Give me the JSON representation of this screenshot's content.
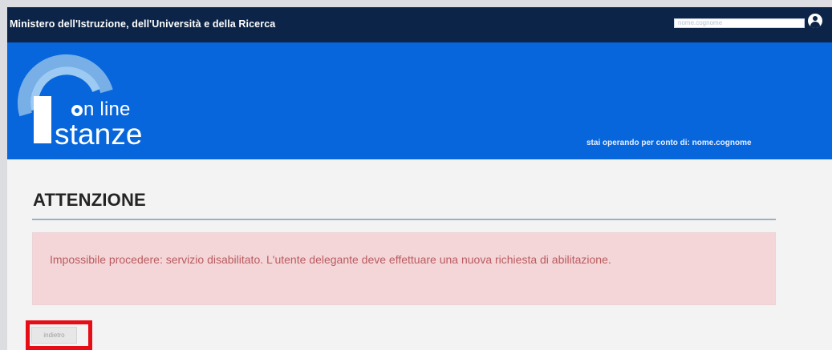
{
  "header": {
    "ministry_name": "Ministero dell'Istruzione, dell'Università e della Ricerca",
    "username_value": "nome.cognome",
    "user_icon": "user-icon"
  },
  "hero": {
    "logo_online": "n line",
    "logo_stanze": "stanze",
    "operating_for": "stai operando per conto di: nome.cognome"
  },
  "main": {
    "title": "ATTENZIONE",
    "alert_message": "Impossibile procedere: servizio disabilitato. L'utente delegante deve effettuare una nuova richiesta di abilitazione.",
    "back_button_label": "indietro"
  },
  "colors": {
    "topbar": "#0b2447",
    "hero": "#0766db",
    "alert_bg": "#f4d5d8",
    "alert_text": "#ba5b5e",
    "highlight": "#e60d16"
  }
}
